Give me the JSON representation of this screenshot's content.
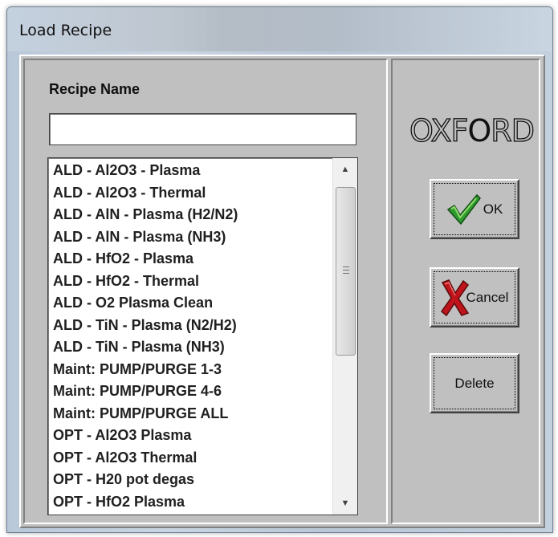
{
  "window": {
    "title": "Load Recipe"
  },
  "form": {
    "recipe_name_label": "Recipe Name",
    "recipe_name_value": ""
  },
  "recipes": [
    "ALD - Al2O3 - Plasma",
    "ALD - Al2O3 - Thermal",
    "ALD - AlN - Plasma (H2/N2)",
    "ALD - AlN - Plasma (NH3)",
    "ALD - HfO2 - Plasma",
    "ALD - HfO2 - Thermal",
    "ALD - O2 Plasma Clean",
    "ALD - TiN - Plasma (N2/H2)",
    "ALD - TiN - Plasma (NH3)",
    "Maint: PUMP/PURGE 1-3",
    "Maint: PUMP/PURGE 4-6",
    "Maint: PUMP/PURGE ALL",
    "OPT - Al2O3 Plasma",
    "OPT - Al2O3 Thermal",
    "OPT - H20 pot degas",
    "OPT - HfO2 Plasma"
  ],
  "logo": {
    "text_before": "OXF",
    "mark": "O",
    "text_after": "RD"
  },
  "buttons": {
    "ok_label": "OK",
    "cancel_label": "Cancel",
    "delete_label": "Delete"
  },
  "icons": {
    "ok": "green-checkmark-icon",
    "cancel": "red-x-icon",
    "scroll_up": "scroll-up-arrow-icon",
    "scroll_down": "scroll-down-arrow-icon"
  },
  "colors": {
    "dialog_background": "#c0c0c0",
    "checkmark": "#2e9b2e",
    "cancel_x": "#c0141c"
  }
}
